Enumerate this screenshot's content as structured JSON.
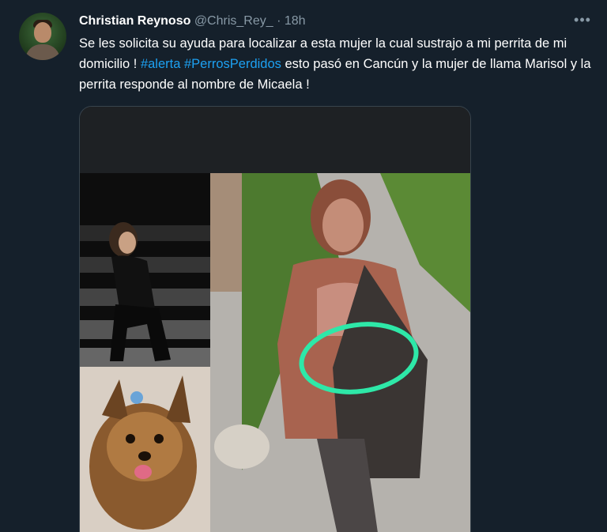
{
  "author": {
    "name": "Christian Reynoso",
    "handle": "@Chris_Rey_",
    "separator": "·",
    "time": "18h"
  },
  "more_icon": "more-horizontal-icon",
  "tweet": {
    "part1": "Se les solicita su ayuda para localizar a esta mujer la cual sustrajo a mi perrita de mi domicilio ! ",
    "hashtag1": "#alerta",
    "hashtag2": "#PerrosPerdidos",
    "part2": " esto pasó en Cancún y la mujer de llama Marisol y la perrita responde al nombre de Micaela !"
  },
  "colors": {
    "background": "#15202b",
    "text": "#ffffff",
    "secondary": "#8899a6",
    "link": "#1da1f2",
    "highlight_circle": "#2ee8a8"
  }
}
